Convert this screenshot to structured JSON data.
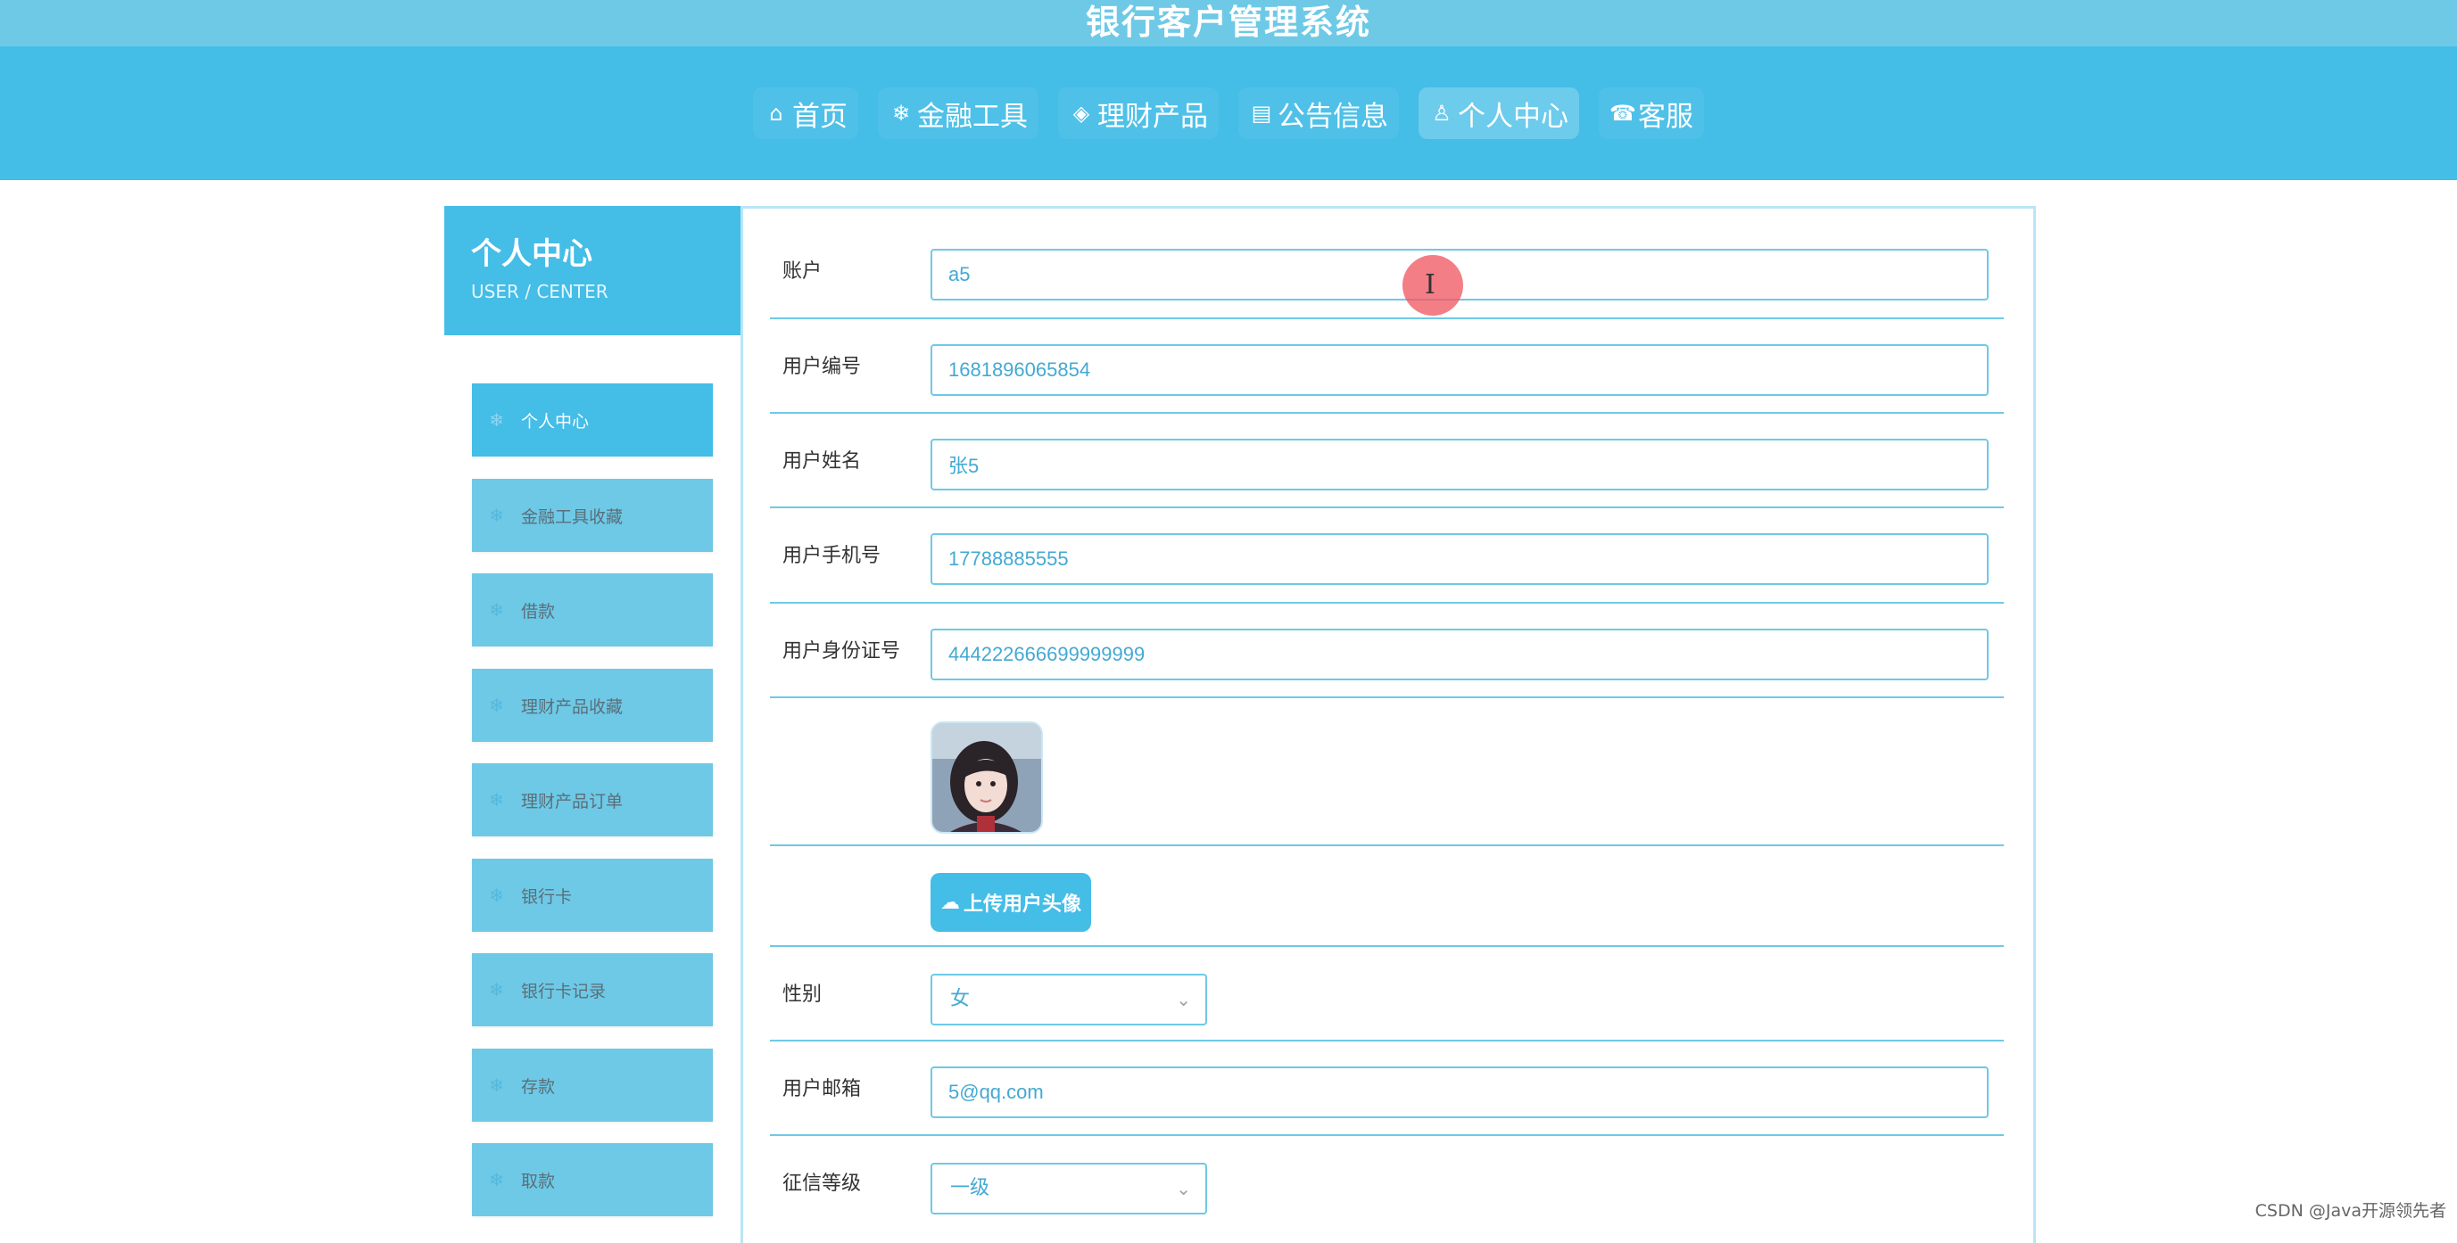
{
  "header": {
    "site_title": "银行客户管理系统"
  },
  "nav": {
    "items": [
      {
        "label": "首页",
        "icon": "home-icon",
        "glyph": "⌂",
        "active": false
      },
      {
        "label": "金融工具",
        "icon": "snowflake-icon",
        "glyph": "❄",
        "active": false
      },
      {
        "label": "理财产品",
        "icon": "layers-icon",
        "glyph": "◈",
        "active": false
      },
      {
        "label": "公告信息",
        "icon": "document-icon",
        "glyph": "▤",
        "active": false
      },
      {
        "label": "个人中心",
        "icon": "user-icon",
        "glyph": "♙",
        "active": true
      },
      {
        "label": "客服",
        "icon": "headset-icon",
        "glyph": "☎",
        "active": false
      }
    ]
  },
  "sidebar": {
    "title": "个人中心",
    "subtitle": "USER / CENTER",
    "items": [
      {
        "label": "个人中心",
        "active": true
      },
      {
        "label": "金融工具收藏",
        "active": false
      },
      {
        "label": "借款",
        "active": false
      },
      {
        "label": "理财产品收藏",
        "active": false
      },
      {
        "label": "理财产品订单",
        "active": false
      },
      {
        "label": "银行卡",
        "active": false
      },
      {
        "label": "银行卡记录",
        "active": false
      },
      {
        "label": "存款",
        "active": false
      },
      {
        "label": "取款",
        "active": false
      }
    ]
  },
  "form": {
    "account": {
      "label": "账户",
      "value": "a5"
    },
    "user_no": {
      "label": "用户编号",
      "value": "1681896065854"
    },
    "user_name": {
      "label": "用户姓名",
      "value": "张5"
    },
    "phone": {
      "label": "用户手机号",
      "value": "17788885555"
    },
    "id_card": {
      "label": "用户身份证号",
      "value": "444222666699999999"
    },
    "upload_label": "上传用户头像",
    "gender": {
      "label": "性别",
      "value": "女"
    },
    "email": {
      "label": "用户邮箱",
      "value": "5@qq.com"
    },
    "credit_level": {
      "label": "征信等级",
      "value": "一级"
    }
  },
  "colors": {
    "primary": "#44bde7",
    "light": "#6ec9e6",
    "field_text": "#44a9d3"
  },
  "watermark": "CSDN @Java开源领先者"
}
